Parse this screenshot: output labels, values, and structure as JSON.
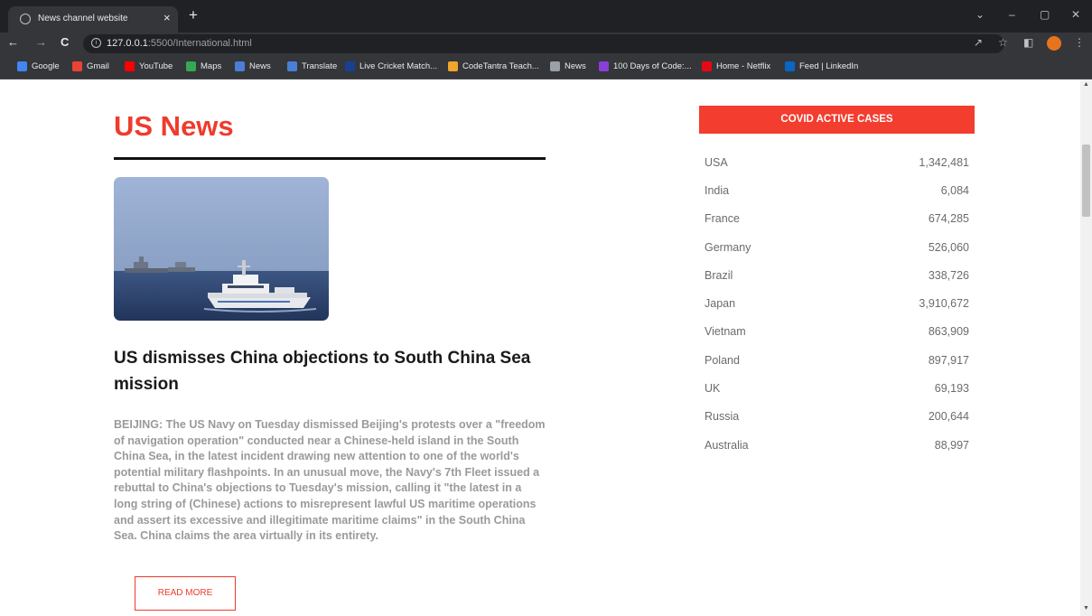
{
  "browser": {
    "tab_title": "News channel website",
    "tab_close": "×",
    "new_tab": "+",
    "url_host": "127.0.0.1",
    "url_rest": ":5500/International.html",
    "bookmarks": [
      {
        "label": "Google",
        "color": "#4285f4"
      },
      {
        "label": "Gmail",
        "color": "#ea4335"
      },
      {
        "label": "YouTube",
        "color": "#ff0000"
      },
      {
        "label": "Maps",
        "color": "#34a853"
      },
      {
        "label": "News",
        "color": "#4a7fd8"
      },
      {
        "label": "Translate",
        "color": "#4a7fd8"
      },
      {
        "label": "Live Cricket Match...",
        "color": "#1b3f8f"
      },
      {
        "label": "CodeTantra Teach...",
        "color": "#f1a52b"
      },
      {
        "label": "News",
        "color": "#9aa0a6"
      },
      {
        "label": "100 Days of Code:...",
        "color": "#8b3fd9"
      },
      {
        "label": "Home - Netflix",
        "color": "#e50914"
      },
      {
        "label": "Feed | LinkedIn",
        "color": "#0a66c2"
      }
    ]
  },
  "main": {
    "section_title": "US News",
    "headline": "US dismisses China objections to South China Sea mission",
    "body": "BEIJING: The US Navy on Tuesday dismissed Beijing's protests over a \"freedom of navigation operation\" conducted near a Chinese-held island in the South China Sea, in the latest incident drawing new attention to one of the world's potential military flashpoints. In an unusual move, the Navy's 7th Fleet issued a rebuttal to China's objections to Tuesday's mission, calling it \"the latest in a long string of (Chinese) actions to misrepresent lawful US maritime operations and assert its excessive and illegitimate maritime claims\" in the South China Sea. China claims the area virtually in its entirety.",
    "read_more": "READ MORE"
  },
  "covid": {
    "header": "COVID ACTIVE CASES",
    "rows": [
      {
        "country": "USA",
        "cases": "1,342,481"
      },
      {
        "country": "India",
        "cases": "6,084"
      },
      {
        "country": "France",
        "cases": "674,285"
      },
      {
        "country": "Germany",
        "cases": "526,060"
      },
      {
        "country": "Brazil",
        "cases": "338,726"
      },
      {
        "country": "Japan",
        "cases": "3,910,672"
      },
      {
        "country": "Vietnam",
        "cases": "863,909"
      },
      {
        "country": "Poland",
        "cases": "897,917"
      },
      {
        "country": "UK",
        "cases": "69,193"
      },
      {
        "country": "Russia",
        "cases": "200,644"
      },
      {
        "country": "Australia",
        "cases": "88,997"
      }
    ]
  },
  "colors": {
    "accent": "#ef3b2d",
    "chrome_dark": "#202124",
    "chrome_mid": "#35363a"
  }
}
